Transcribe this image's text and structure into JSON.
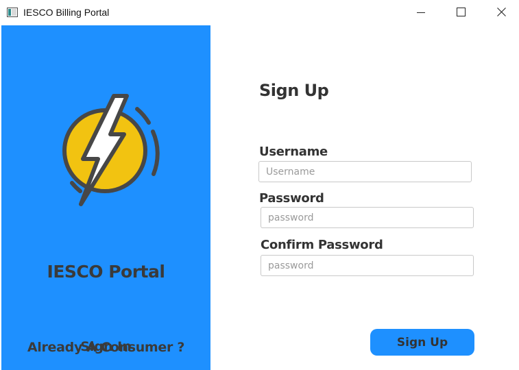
{
  "window": {
    "title": "IESCO Billing Portal"
  },
  "left_panel": {
    "logo_icon": "lightning-bolt-icon",
    "portal_title": "IESCO Portal",
    "already_text": "Already A Consumer ?",
    "signin_label": "Sign In"
  },
  "form": {
    "heading": "Sign Up",
    "username": {
      "label": "Username",
      "placeholder": "Username",
      "value": ""
    },
    "password": {
      "label": "Password",
      "placeholder": "password",
      "value": ""
    },
    "confirm_password": {
      "label": "Confirm Password",
      "placeholder": "password",
      "value": ""
    },
    "submit_label": "Sign Up"
  },
  "colors": {
    "panel_blue": "#1e90ff",
    "bolt_yellow": "#f2c311",
    "text_dark": "#333333"
  }
}
